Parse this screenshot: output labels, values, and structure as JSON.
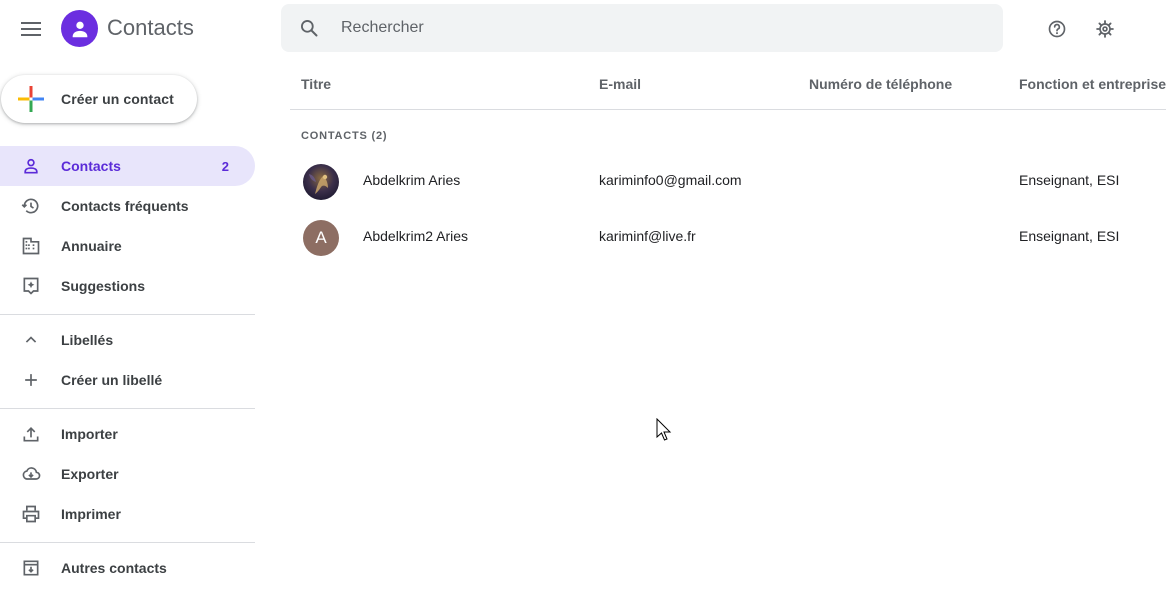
{
  "header": {
    "app_title": "Contacts",
    "search_placeholder": "Rechercher"
  },
  "sidebar": {
    "create_contact_label": "Créer un contact",
    "items": [
      {
        "label": "Contacts",
        "count": "2",
        "icon": "person-icon",
        "active": true
      },
      {
        "label": "Contacts fréquents",
        "icon": "history-icon"
      },
      {
        "label": "Annuaire",
        "icon": "domain-icon"
      },
      {
        "label": "Suggestions",
        "icon": "suggestions-icon"
      }
    ],
    "labels_section": {
      "header_label": "Libellés",
      "create_label": "Créer un libellé"
    },
    "actions": [
      {
        "label": "Importer",
        "icon": "upload-icon"
      },
      {
        "label": "Exporter",
        "icon": "cloud-download-icon"
      },
      {
        "label": "Imprimer",
        "icon": "print-icon"
      }
    ],
    "other_contacts_label": "Autres contacts"
  },
  "table": {
    "columns": [
      "Titre",
      "E-mail",
      "Numéro de téléphone",
      "Fonction et entreprise"
    ],
    "section_label": "CONTACTS (2)",
    "rows": [
      {
        "name": "Abdelkrim Aries",
        "email": "kariminfo0@gmail.com",
        "phone": "",
        "job": "Enseignant, ESI",
        "avatar": "photo"
      },
      {
        "name": "Abdelkrim2 Aries",
        "email": "kariminf@live.fr",
        "phone": "",
        "job": "Enseignant, ESI",
        "avatar": "A"
      }
    ]
  },
  "colors": {
    "brand": "#6b2ee0",
    "active_bg": "#e8e5fb",
    "active_text": "#5b2bd8",
    "letter_avatar_bg": "#8d6e63"
  }
}
